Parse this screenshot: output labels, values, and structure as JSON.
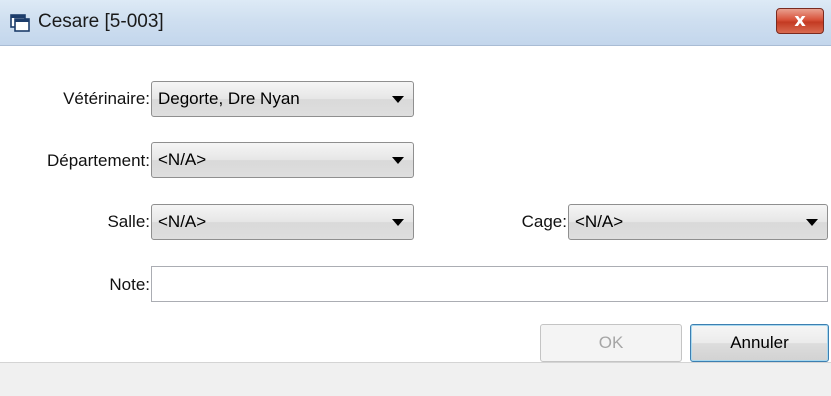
{
  "window": {
    "title": "Cesare [5-003]",
    "close_label": "x"
  },
  "form": {
    "veterinaire": {
      "label": "Vétérinaire:",
      "value": "Degorte, Dre Nyan"
    },
    "departement": {
      "label": "Département:",
      "value": "<N/A>"
    },
    "salle": {
      "label": "Salle:",
      "value": "<N/A>"
    },
    "cage": {
      "label": "Cage:",
      "value": "<N/A>"
    },
    "note": {
      "label": "Note:",
      "value": ""
    }
  },
  "buttons": {
    "ok_label": "OK",
    "cancel_label": "Annuler"
  }
}
